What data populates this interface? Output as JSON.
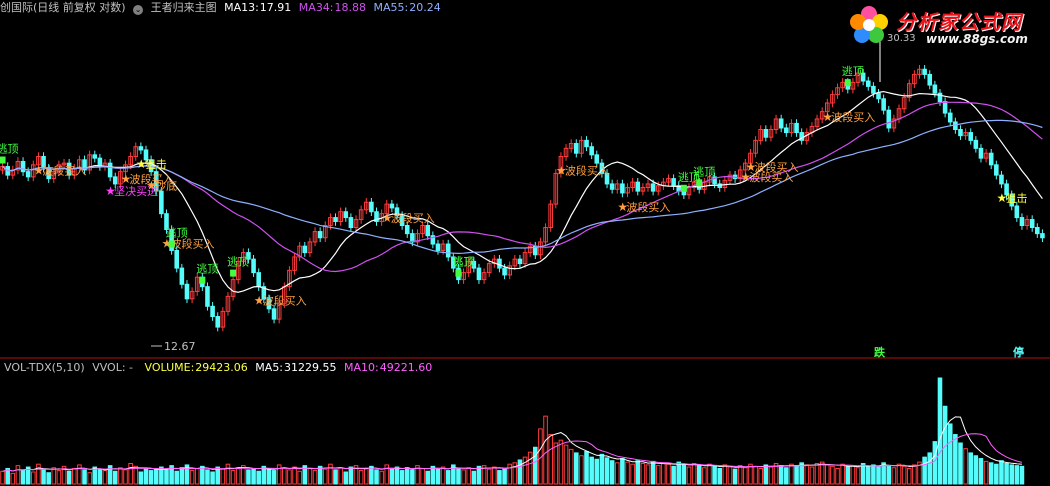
{
  "header": {
    "title": "创国际(日线 前复权 对数)",
    "indicator_name": "王者归来主图",
    "ma13_label": "MA13:",
    "ma13_value": "17.91",
    "ma34_label": "MA34:",
    "ma34_value": "18.88",
    "ma55_label": "MA55:",
    "ma55_value": "20.24"
  },
  "volume_header": {
    "name": "VOL-TDX(5,10)",
    "vvol": "VVOL: -",
    "volume_label": "VOLUME:",
    "volume_value": "29423.06",
    "ma5_label": "MA5:",
    "ma5_value": "31229.55",
    "ma10_label": "MA10:",
    "ma10_value": "49221.60"
  },
  "logo": {
    "text": "分析家公式网",
    "url": "www.88gs.com"
  },
  "price_annotations": {
    "high": "30.33",
    "low": "12.67"
  },
  "corner_labels": {
    "die": "跌",
    "ting": "停"
  },
  "colors": {
    "background": "#000000",
    "up_candle": "#ff3c3c",
    "down_candle": "#54fcfc",
    "ma13": "#ffffff",
    "ma34": "#d050f0",
    "ma55": "#8fb0ff",
    "signal_green": "#40ff40",
    "signal_orange": "#ffa040",
    "signal_magenta": "#ff40ff",
    "signal_yellow": "#ffff40"
  },
  "chart_data": [
    {
      "type": "candlestick",
      "title": "王者归来主图",
      "scale": "log",
      "ylim": [
        12.3,
        31.5
      ],
      "x_count": 200,
      "series": [
        {
          "name": "MA13",
          "key": "ma13"
        },
        {
          "name": "MA34",
          "key": "ma34"
        },
        {
          "name": "MA55",
          "key": "ma55"
        }
      ],
      "close": [
        20.8,
        20.3,
        20.6,
        21.1,
        20.5,
        20.2,
        20.9,
        21.4,
        20.7,
        20.1,
        20.5,
        20.9,
        21.0,
        20.3,
        20.7,
        21.2,
        20.6,
        21.5,
        21.3,
        20.8,
        21.0,
        20.2,
        19.8,
        20.5,
        20.9,
        21.4,
        22.0,
        21.8,
        21.2,
        20.5,
        19.4,
        18.2,
        17.4,
        16.4,
        15.6,
        14.9,
        14.3,
        14.6,
        15.2,
        14.8,
        14.0,
        13.6,
        13.2,
        13.8,
        14.4,
        15.1,
        15.9,
        16.3,
        16.0,
        15.4,
        14.8,
        14.3,
        13.9,
        13.5,
        14.1,
        14.8,
        15.5,
        16.1,
        16.6,
        16.3,
        16.8,
        17.3,
        17.0,
        17.6,
        18.0,
        17.8,
        18.3,
        18.0,
        17.5,
        17.9,
        18.4,
        18.8,
        18.3,
        17.8,
        18.2,
        18.7,
        18.5,
        18.1,
        17.6,
        17.2,
        16.8,
        17.2,
        17.6,
        17.1,
        16.7,
        16.4,
        16.7,
        16.1,
        15.6,
        15.1,
        15.4,
        15.9,
        15.6,
        15.1,
        15.4,
        15.8,
        16.0,
        15.6,
        15.3,
        15.7,
        16.0,
        15.8,
        16.3,
        16.6,
        16.2,
        16.8,
        17.5,
        18.7,
        20.4,
        21.4,
        21.9,
        22.2,
        21.6,
        22.4,
        22.0,
        21.5,
        21.0,
        20.4,
        19.8,
        19.5,
        19.8,
        19.3,
        19.6,
        19.9,
        19.4,
        19.6,
        19.8,
        19.4,
        19.7,
        19.9,
        20.1,
        19.7,
        19.4,
        19.2,
        19.6,
        19.9,
        19.5,
        19.9,
        20.2,
        19.8,
        19.6,
        20.0,
        20.3,
        20.1,
        20.6,
        21.0,
        21.6,
        22.4,
        23.1,
        22.6,
        23.1,
        23.8,
        23.2,
        22.9,
        23.5,
        22.9,
        22.4,
        22.9,
        23.3,
        23.8,
        24.3,
        24.9,
        25.5,
        26.0,
        26.4,
        25.9,
        26.4,
        27.1,
        26.5,
        26.1,
        25.6,
        25.2,
        24.4,
        23.2,
        23.8,
        24.5,
        25.3,
        26.3,
        27.0,
        27.4,
        27.0,
        26.2,
        25.6,
        25.0,
        24.2,
        23.6,
        23.1,
        22.7,
        22.9,
        22.4,
        21.9,
        21.3,
        21.6,
        20.9,
        20.3,
        19.8,
        19.2,
        18.6,
        18.0,
        17.6,
        17.9,
        17.5,
        17.2,
        17.0
      ],
      "high_label": "30.33",
      "low_label": "12.67",
      "signals": [
        {
          "text": "逃顶",
          "x": 0,
          "kind": "green"
        },
        {
          "text": "波段买入",
          "x": 14,
          "kind": "orange"
        },
        {
          "text": "坚决买进",
          "x": 42,
          "kind": "magenta"
        },
        {
          "text": "狙击",
          "x": 54,
          "kind": "yellow"
        },
        {
          "text": "波段买入",
          "x": 48,
          "kind": "orange"
        },
        {
          "text": "抄底",
          "x": 58,
          "kind": "orange"
        },
        {
          "text": "波段买入",
          "x": 64,
          "kind": "orange"
        },
        {
          "text": "逃顶",
          "x": 66,
          "kind": "green"
        },
        {
          "text": "逃顶",
          "x": 78,
          "kind": "green"
        },
        {
          "text": "逃顶",
          "x": 89,
          "kind": "green"
        },
        {
          "text": "波段买入",
          "x": 99,
          "kind": "orange"
        },
        {
          "text": "波段买入",
          "x": 150,
          "kind": "orange"
        },
        {
          "text": "逃顶",
          "x": 177,
          "kind": "green"
        },
        {
          "text": "逃顶",
          "x": 178,
          "kind": "green"
        },
        {
          "text": "波段买入",
          "x": 218,
          "kind": "orange"
        },
        {
          "text": "波段买入",
          "x": 242,
          "kind": "orange"
        },
        {
          "text": "逃顶",
          "x": 266,
          "kind": "green"
        },
        {
          "text": "逃顶",
          "x": 272,
          "kind": "green"
        },
        {
          "text": "波段买入",
          "x": 289,
          "kind": "orange"
        },
        {
          "text": "波段买入",
          "x": 291,
          "kind": "orange"
        },
        {
          "text": "逃顶",
          "x": 330,
          "kind": "green"
        },
        {
          "text": "波段买入",
          "x": 321,
          "kind": "orange"
        },
        {
          "text": "狙击",
          "x": 390,
          "kind": "yellow"
        }
      ]
    },
    {
      "type": "bar",
      "title": "VOL-TDX(5,10)",
      "x_count": 200,
      "series": [
        {
          "name": "MA5",
          "key": "ma5"
        },
        {
          "name": "MA10",
          "key": "ma10"
        }
      ],
      "volume": [
        18,
        22,
        15,
        26,
        19,
        24,
        17,
        28,
        21,
        16,
        23,
        19,
        25,
        18,
        22,
        27,
        20,
        16,
        24,
        21,
        19,
        26,
        18,
        23,
        20,
        29,
        25,
        17,
        22,
        19,
        21,
        24,
        20,
        26,
        18,
        23,
        27,
        19,
        22,
        25,
        20,
        17,
        24,
        21,
        28,
        19,
        23,
        26,
        20,
        22,
        18,
        25,
        21,
        19,
        27,
        23,
        20,
        24,
        18,
        26,
        22,
        19,
        25,
        21,
        28,
        20,
        23,
        17,
        24,
        26,
        19,
        22,
        25,
        20,
        18,
        27,
        21,
        24,
        19,
        23,
        20,
        26,
        22,
        18,
        25,
        21,
        24,
        19,
        27,
        22,
        20,
        23,
        18,
        25,
        26,
        21,
        24,
        19,
        22,
        28,
        30,
        34,
        38,
        45,
        52,
        78,
        96,
        70,
        58,
        62,
        55,
        49,
        44,
        40,
        46,
        38,
        35,
        42,
        37,
        33,
        30,
        36,
        31,
        28,
        33,
        29,
        27,
        32,
        26,
        30,
        28,
        25,
        31,
        27,
        24,
        29,
        26,
        23,
        28,
        25,
        22,
        27,
        24,
        21,
        26,
        23,
        28,
        25,
        22,
        27,
        24,
        29,
        26,
        23,
        28,
        25,
        30,
        27,
        24,
        29,
        31,
        27,
        25,
        22,
        28,
        24,
        26,
        23,
        29,
        25,
        27,
        24,
        30,
        26,
        23,
        28,
        25,
        22,
        27,
        31,
        38,
        44,
        60,
        150,
        110,
        85,
        70,
        58,
        50,
        44,
        40,
        36,
        32,
        30,
        28,
        33,
        29,
        27,
        26,
        25
      ]
    }
  ]
}
